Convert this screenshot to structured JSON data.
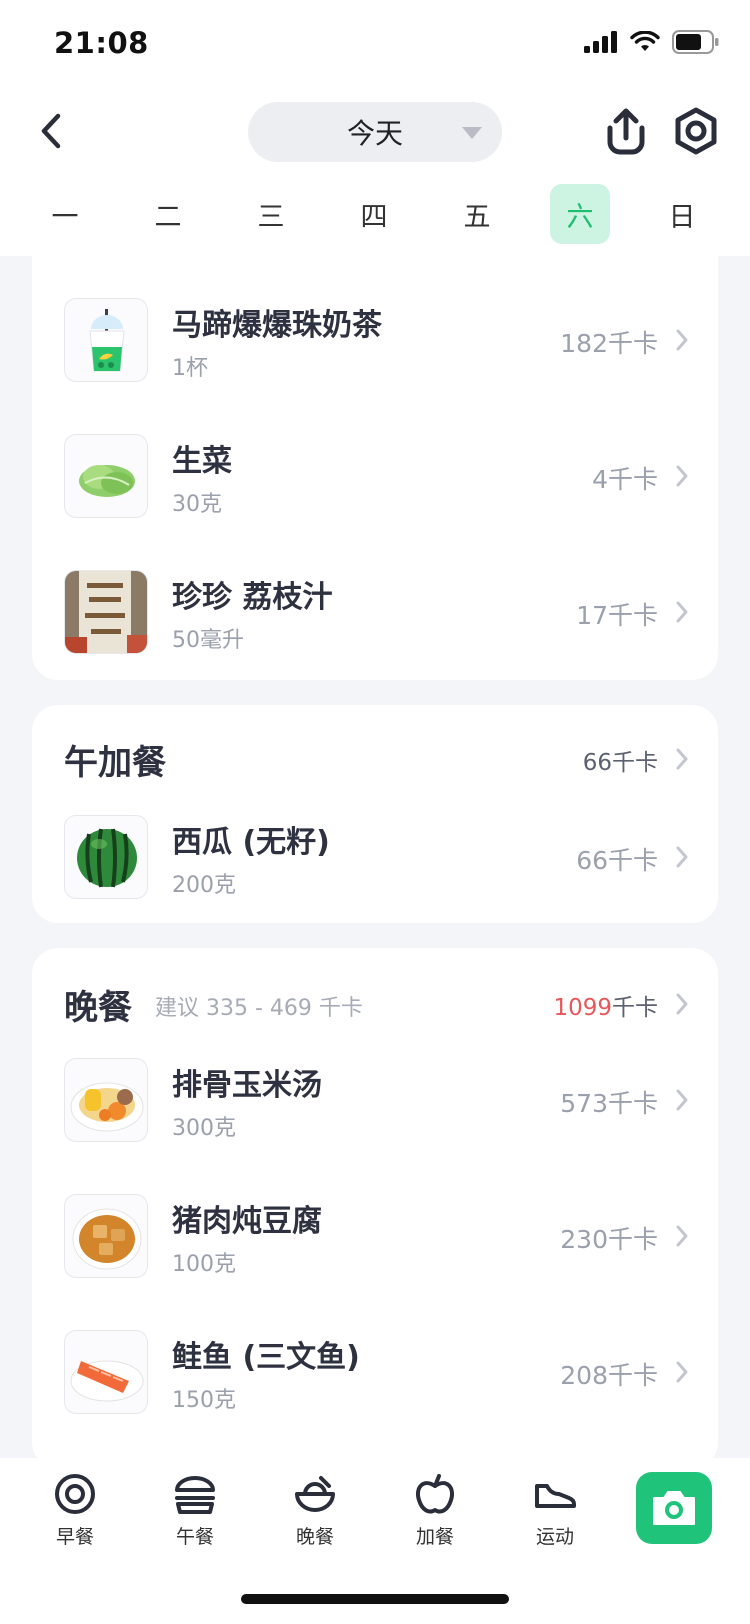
{
  "status": {
    "time": "21:08"
  },
  "header": {
    "date_label": "今天"
  },
  "week": {
    "days": [
      "一",
      "二",
      "三",
      "四",
      "五",
      "六",
      "日"
    ],
    "active_index": 5
  },
  "colors": {
    "accent": "#1fc47a",
    "active_day_bg": "#cdf3e2",
    "over_kcal": "#e8575a"
  },
  "breakfast_card": {
    "items": [
      {
        "name": "马蹄爆爆珠奶茶",
        "amount": "1杯",
        "kcal": "182千卡",
        "icon": "milk-tea-icon"
      },
      {
        "name": "生菜",
        "amount": "30克",
        "kcal": "4千卡",
        "icon": "lettuce-photo"
      },
      {
        "name": "珍珍 荔枝汁",
        "amount": "50毫升",
        "kcal": "17千卡",
        "icon": "lychee-juice-photo"
      }
    ]
  },
  "afternoon_snack": {
    "title": "午加餐",
    "total": "66千卡",
    "items": [
      {
        "name": "西瓜 (无籽)",
        "amount": "200克",
        "kcal": "66千卡",
        "icon": "watermelon-photo"
      }
    ]
  },
  "dinner": {
    "title": "晚餐",
    "hint": "建议 335 - 469 千卡",
    "total_value": "1099",
    "total_unit": "千卡",
    "items": [
      {
        "name": "排骨玉米汤",
        "amount": "300克",
        "kcal": "573千卡",
        "icon": "rib-corn-soup-photo"
      },
      {
        "name": "猪肉炖豆腐",
        "amount": "100克",
        "kcal": "230千卡",
        "icon": "pork-tofu-photo"
      },
      {
        "name": "鲑鱼 (三文鱼)",
        "amount": "150克",
        "kcal": "208千卡",
        "icon": "salmon-photo"
      }
    ]
  },
  "bottom_nav": {
    "tabs": [
      {
        "label": "早餐",
        "icon": "breakfast-egg-icon"
      },
      {
        "label": "午餐",
        "icon": "lunch-burger-icon"
      },
      {
        "label": "晚餐",
        "icon": "dinner-bowl-icon"
      },
      {
        "label": "加餐",
        "icon": "snack-apple-icon"
      },
      {
        "label": "运动",
        "icon": "exercise-shoe-icon"
      }
    ],
    "camera_icon": "camera-icon"
  }
}
